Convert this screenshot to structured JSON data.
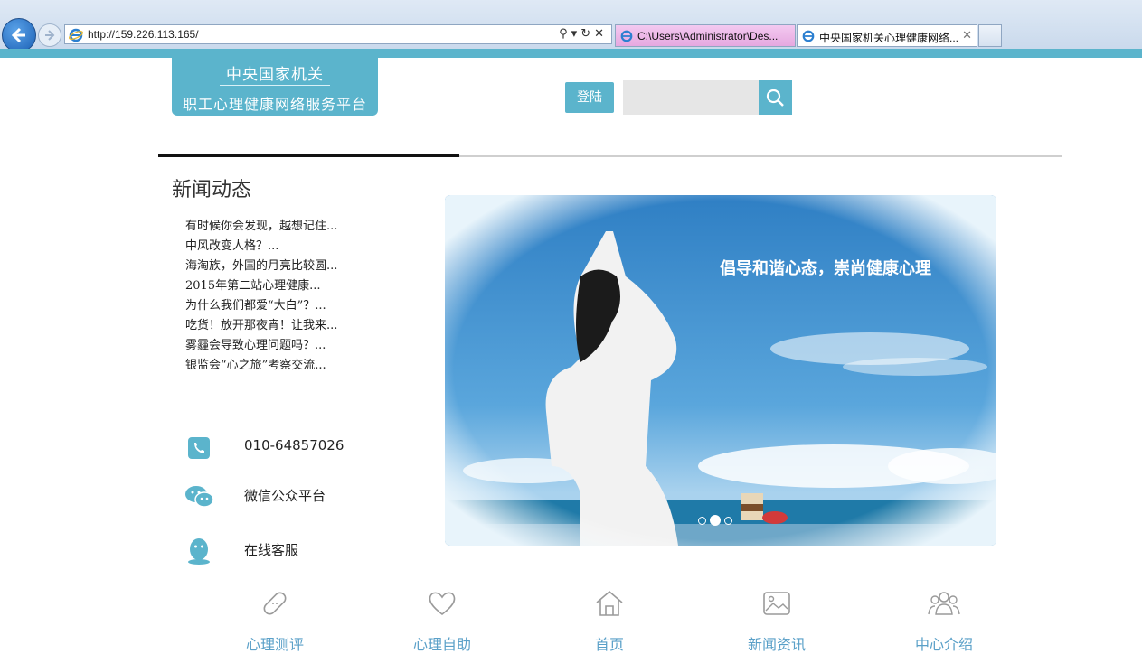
{
  "browser": {
    "url": "http://159.226.113.165/",
    "tabs": [
      {
        "title": "C:\\Users\\Administrator\\Des..."
      },
      {
        "title": "中央国家机关心理健康网络..."
      }
    ],
    "colors": {
      "tab_pink": "#e6a8e0",
      "band": "#5bb4cc"
    }
  },
  "header": {
    "logo_line1": "中央国家机关",
    "logo_line2": "职工心理健康网络服务平台",
    "login_label": "登陆",
    "search_placeholder": ""
  },
  "news": {
    "title": "新闻动态",
    "items": [
      "有时候你会发现，越想记住...",
      "中风改变人格？...",
      "海淘族，外国的月亮比较圆...",
      "2015年第二站心理健康...",
      "为什么我们都爱“大白”？...",
      "吃货！放开那夜宵！让我来...",
      "雾霾会导致心理问题吗？...",
      "银监会“心之旅”考察交流..."
    ]
  },
  "contact": {
    "phone": "010-64857026",
    "wechat": "微信公众平台",
    "service": "在线客服",
    "icons": [
      "phone-icon",
      "wechat-icon",
      "qq-icon"
    ]
  },
  "banner": {
    "caption": "倡导和谐心态，崇尚健康心理",
    "slide_count": 3,
    "active_slide": 2
  },
  "bottom_nav": [
    {
      "label": "心理测评",
      "icon": "bandage-icon"
    },
    {
      "label": "心理自助",
      "icon": "heart-icon"
    },
    {
      "label": "首页",
      "icon": "home-icon"
    },
    {
      "label": "新闻资讯",
      "icon": "picture-icon"
    },
    {
      "label": "中心介绍",
      "icon": "group-icon"
    }
  ],
  "theme": {
    "accent": "#5bb4cc",
    "nav_text": "#5aa0c8"
  }
}
